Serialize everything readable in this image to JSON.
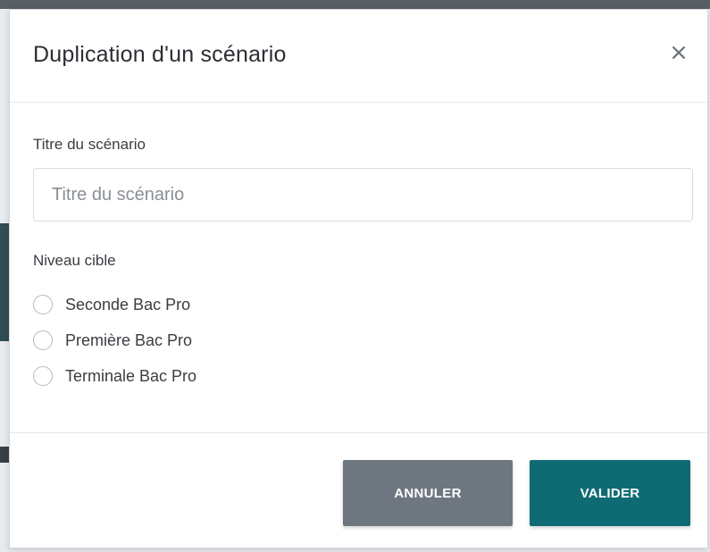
{
  "modal": {
    "title": "Duplication d'un scénario",
    "close_icon": "close-icon",
    "close_glyph": "×"
  },
  "form": {
    "title_field": {
      "label": "Titre du scénario",
      "placeholder": "Titre du scénario",
      "value": ""
    },
    "level_field": {
      "label": "Niveau cible",
      "options": [
        {
          "label": "Seconde Bac Pro",
          "selected": false
        },
        {
          "label": "Première Bac Pro",
          "selected": false
        },
        {
          "label": "Terminale Bac Pro",
          "selected": false
        }
      ]
    }
  },
  "footer": {
    "cancel_label": "ANNULER",
    "validate_label": "VALIDER"
  },
  "colors": {
    "cancel_button": "#6e767f",
    "validate_button": "#0f6b73"
  }
}
